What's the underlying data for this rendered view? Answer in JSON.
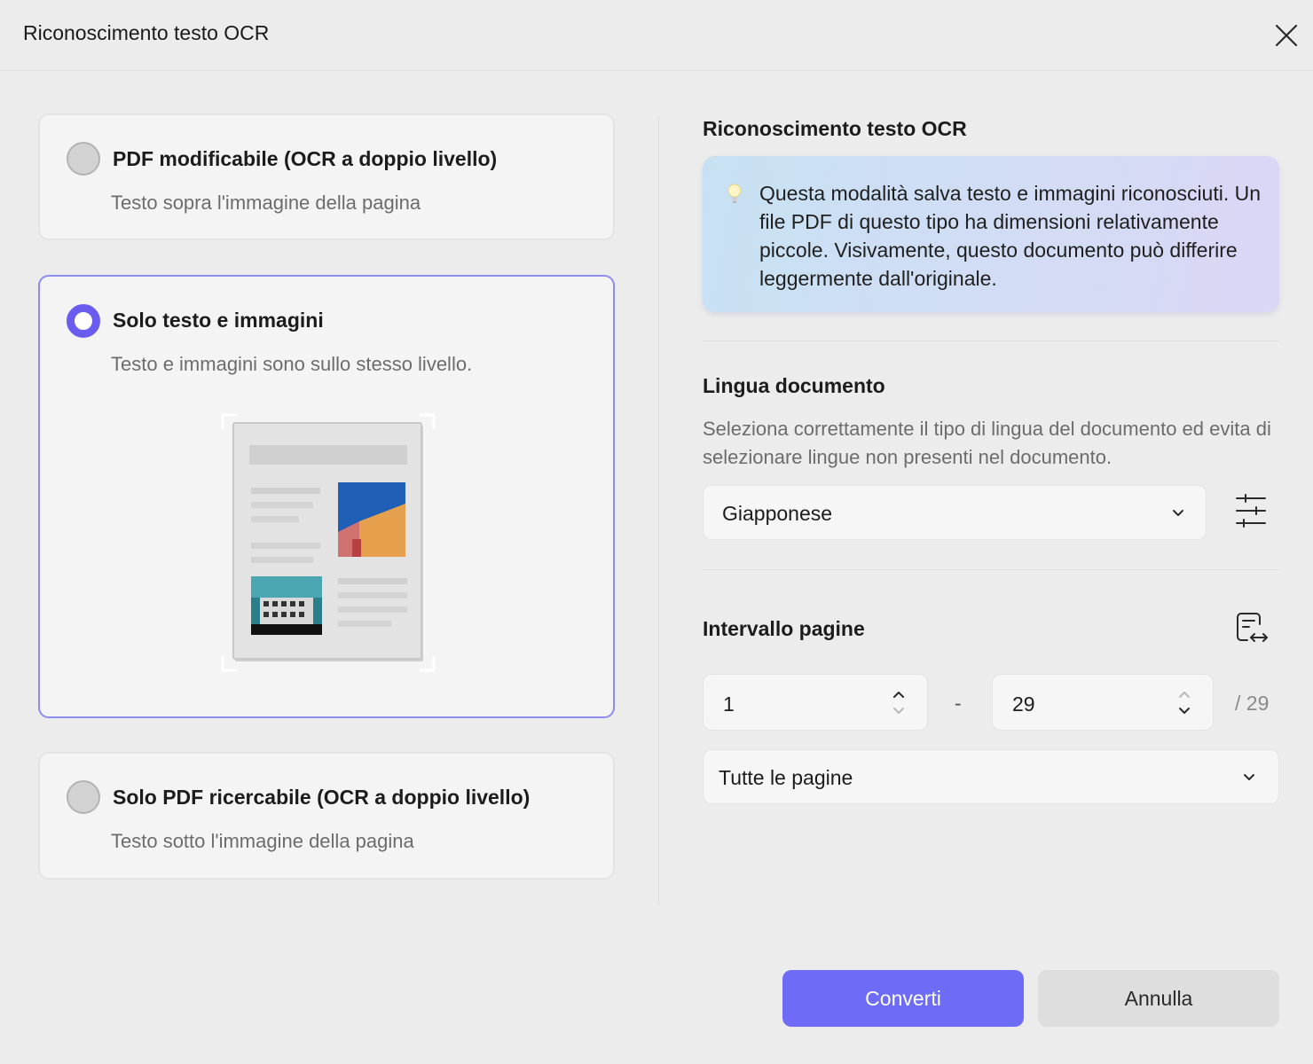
{
  "window": {
    "title": "Riconoscimento testo OCR",
    "close_icon": "close-icon"
  },
  "options": [
    {
      "title": "PDF modificabile (OCR a doppio livello)",
      "description": "Testo sopra l'immagine della pagina",
      "selected": false
    },
    {
      "title": "Solo testo e immagini",
      "description": "Testo e immagini sono sullo stesso livello.",
      "selected": true
    },
    {
      "title": "Solo PDF ricercabile (OCR a doppio livello)",
      "description": "Testo sotto l'immagine della pagina",
      "selected": false
    }
  ],
  "right_panel": {
    "heading": "Riconoscimento testo OCR",
    "info": {
      "icon": "lightbulb-icon",
      "text": "Questa modalità salva testo e immagini riconosciuti. Un file PDF di questo tipo ha dimensioni relativamente piccole. Visivamente, questo documento può differire leggermente dall'originale."
    },
    "language": {
      "heading": "Lingua documento",
      "description": "Seleziona correttamente il tipo di lingua del documento ed evita di selezionare lingue non presenti nel documento.",
      "selected": "Giapponese",
      "settings_icon": "sliders-icon"
    },
    "page_range": {
      "heading": "Intervallo pagine",
      "from": "1",
      "separator": "-",
      "to": "29",
      "total": "/ 29",
      "mode": "Tutte le pagine",
      "range_icon": "page-range-icon"
    }
  },
  "buttons": {
    "convert": "Converti",
    "cancel": "Annulla"
  },
  "colors": {
    "accent": "#6e6cf6",
    "selected_border": "#8f8cf0",
    "radio_selected": "#6b5cf0",
    "background": "#ececec"
  }
}
